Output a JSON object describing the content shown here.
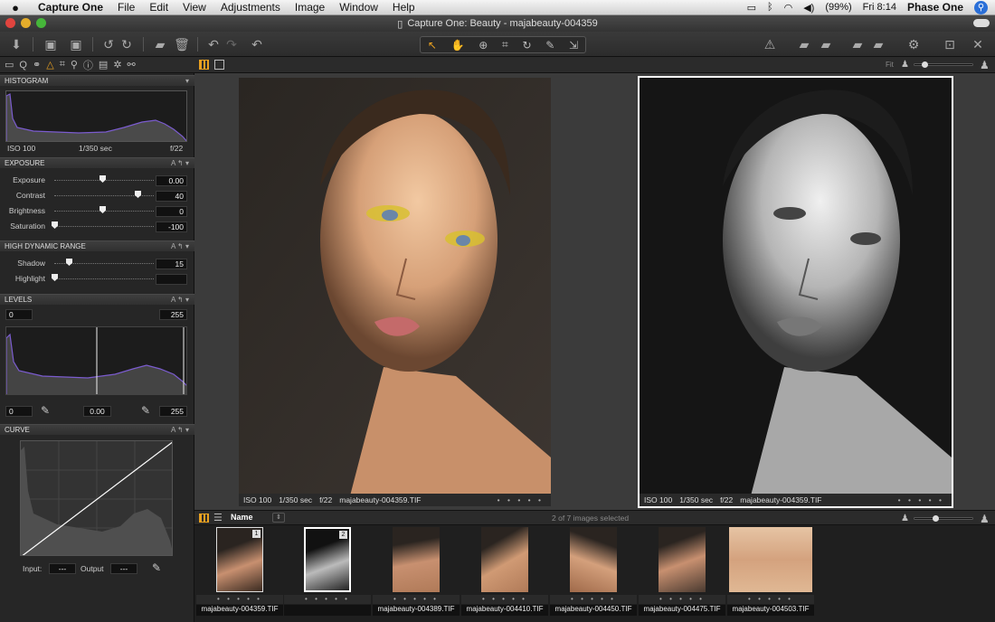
{
  "menubar": {
    "apple": "",
    "app_name": "Capture One",
    "items": [
      "File",
      "Edit",
      "View",
      "Adjustments",
      "Image",
      "Window",
      "Help"
    ],
    "battery": "(99%)",
    "clock": "Fri 8:14",
    "user": "Phase One"
  },
  "window": {
    "title": "Capture One: Beauty - majabeauty-004359"
  },
  "tool_tabs": {
    "icons": [
      "folder-icon",
      "search-icon",
      "color-balance-icon",
      "exposure-icon",
      "crop-icon",
      "focus-icon",
      "info-icon",
      "metadata-icon",
      "settings-icon",
      "adjustments-icon"
    ]
  },
  "viewer_bar": {
    "fit_label": "Fit"
  },
  "histogram": {
    "header": "HISTOGRAM",
    "iso": "ISO 100",
    "shutter": "1/350 sec",
    "aperture": "f/22"
  },
  "exposure": {
    "header": "EXPOSURE",
    "ctl": "A ↰ ▾",
    "sliders": [
      {
        "label": "Exposure",
        "value": "0.00",
        "level": 0.5
      },
      {
        "label": "Contrast",
        "value": "40",
        "level": 0.7
      },
      {
        "label": "Brightness",
        "value": "0",
        "level": 0.5
      },
      {
        "label": "Saturation",
        "value": "-100",
        "level": 0.0
      }
    ]
  },
  "hdr": {
    "header": "HIGH DYNAMIC RANGE",
    "ctl": "A ↰ ▾",
    "sliders": [
      {
        "label": "Shadow",
        "value": "15",
        "level": 0.15
      },
      {
        "label": "Highlight",
        "value": "",
        "level": 0.0
      }
    ]
  },
  "levels": {
    "header": "LEVELS",
    "ctl": "A ↰ ▾",
    "in_low": "0",
    "in_high": "255",
    "out_low": "0",
    "mid": "0.00",
    "out_high": "255"
  },
  "curve": {
    "header": "CURVE",
    "ctl": "A ↰ ▾",
    "input_label": "Input:",
    "input_value": "---",
    "output_label": "Output",
    "output_value": "---"
  },
  "viewer": {
    "left": {
      "iso": "ISO 100",
      "shutter": "1/350 sec",
      "aperture": "f/22",
      "filename": "majabeauty-004359.TIF",
      "dots": "• • • • •"
    },
    "right": {
      "iso": "ISO 100",
      "shutter": "1/350 sec",
      "aperture": "f/22",
      "filename": "majabeauty-004359.TIF",
      "dots": "• • • • •"
    }
  },
  "browser_bar": {
    "sort_label": "Name",
    "count": "2 of 7 images selected"
  },
  "thumbnails": [
    {
      "name": "majabeauty-004359.TIF",
      "badge": "1",
      "dots": "• • • • •"
    },
    {
      "name": "",
      "badge": "2",
      "dots": "• • • • •"
    },
    {
      "name": "majabeauty-004389.TIF",
      "badge": "",
      "dots": "• • • • •"
    },
    {
      "name": "majabeauty-004410.TIF",
      "badge": "",
      "dots": "• • • • •"
    },
    {
      "name": "majabeauty-004450.TIF",
      "badge": "",
      "dots": "• • • • •"
    },
    {
      "name": "majabeauty-004475.TIF",
      "badge": "",
      "dots": "• • • • •"
    },
    {
      "name": "majabeauty-004503.TIF",
      "badge": "",
      "dots": "• • • • •"
    }
  ],
  "colors": {
    "accent": "#e8a020",
    "histogram_line": "#7b5ccf"
  }
}
